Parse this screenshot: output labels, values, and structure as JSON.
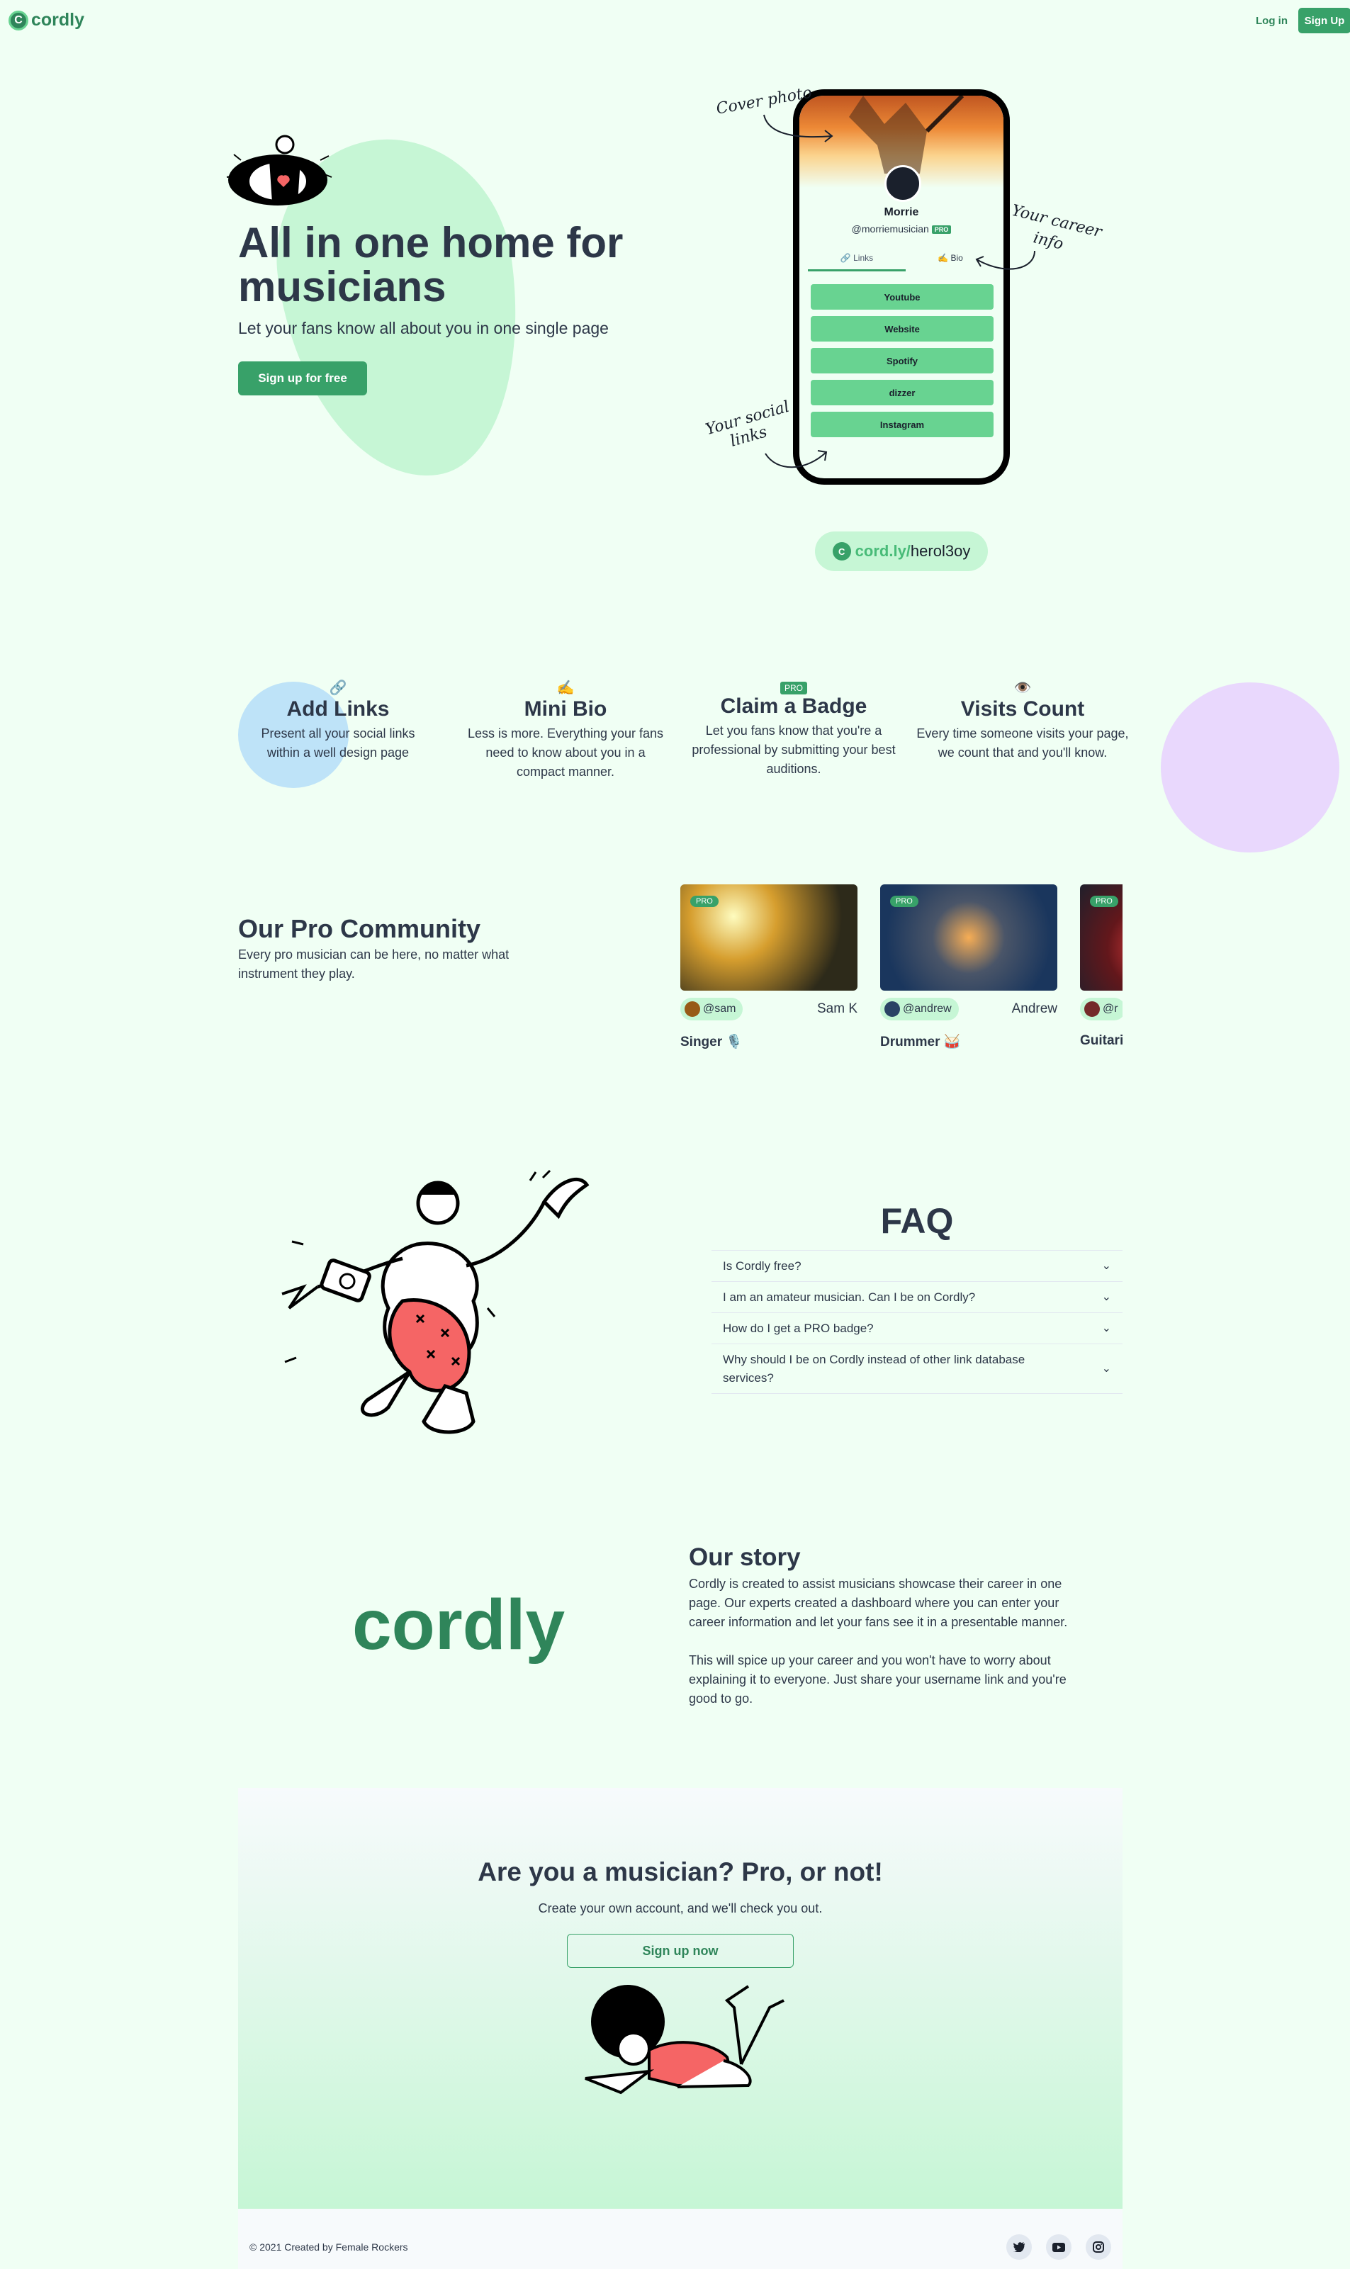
{
  "header": {
    "logo_letter": "C",
    "logo_text": "cordly",
    "login": "Log in",
    "signup": "Sign Up"
  },
  "hero": {
    "title": "All in one home for musicians",
    "subtitle": "Let your fans know all about you in one single page",
    "cta": "Sign up for free"
  },
  "phone": {
    "name": "Morrie",
    "handle": "@morriemusician",
    "pro": "PRO",
    "tabs": {
      "links": "🔗 Links",
      "bio": "✍️ Bio"
    },
    "links": [
      "Youtube",
      "Website",
      "Spotify",
      "dizzer",
      "Instagram"
    ]
  },
  "annotations": {
    "cover": "Cover photo",
    "career_1": "Your career",
    "career_2": "info",
    "social_1": "Your social",
    "social_2": "links"
  },
  "url": {
    "letter": "C",
    "domain": "cord.ly/",
    "user": "herol3oy"
  },
  "features": [
    {
      "icon": "🔗",
      "title": "Add Links",
      "desc": "Present all your social links within a well design page"
    },
    {
      "icon": "✍️",
      "title": "Mini Bio",
      "desc": "Less is more. Everything your fans need to know about you in a compact manner."
    },
    {
      "badge": "PRO",
      "title": "Claim a Badge",
      "desc": "Let you fans know that you're a professional by submitting your best auditions."
    },
    {
      "icon": "👁️",
      "title": "Visits Count",
      "desc": "Every time someone visits your page, we count that and you'll know."
    }
  ],
  "community": {
    "title": "Our Pro Community",
    "subtitle": "Every pro musician can be here, no matter what instrument they play.",
    "cards": [
      {
        "pro": "PRO",
        "user": "@sam",
        "name": "Sam K",
        "role": "Singer 🎙️"
      },
      {
        "pro": "PRO",
        "user": "@andrew",
        "name": "Andrew",
        "role": "Drummer 🥁"
      },
      {
        "pro": "PRO",
        "user": "@r",
        "name": "",
        "role": "Guitari"
      }
    ]
  },
  "faq": {
    "title": "FAQ",
    "items": [
      "Is Cordly free?",
      "I am an amateur musician. Can I be on Cordly?",
      "How do I get a PRO badge?",
      "Why should I be on Cordly instead of other link database services?"
    ]
  },
  "story": {
    "logo": "cordly",
    "title": "Our story",
    "p1": "Cordly is created to assist musicians showcase their career in one page. Our experts created a dashboard where you can enter your career information and let your fans see it in a presentable manner.",
    "p2": "This will spice up your career and you won't have to worry about explaining it to everyone. Just share your username link and you're good to go."
  },
  "cta": {
    "title": "Are you a musician? Pro, or not!",
    "subtitle": "Create your own account, and we'll check you out.",
    "button": "Sign up now"
  },
  "footer": {
    "copyright": "© 2021 Created by Female Rockers",
    "social": [
      "twitter-icon",
      "youtube-icon",
      "instagram-icon"
    ]
  },
  "colors": {
    "brand": "#38a169",
    "brand_dark": "#2f855a",
    "mint": "#c6f6d5",
    "background": "#f0fff4"
  }
}
